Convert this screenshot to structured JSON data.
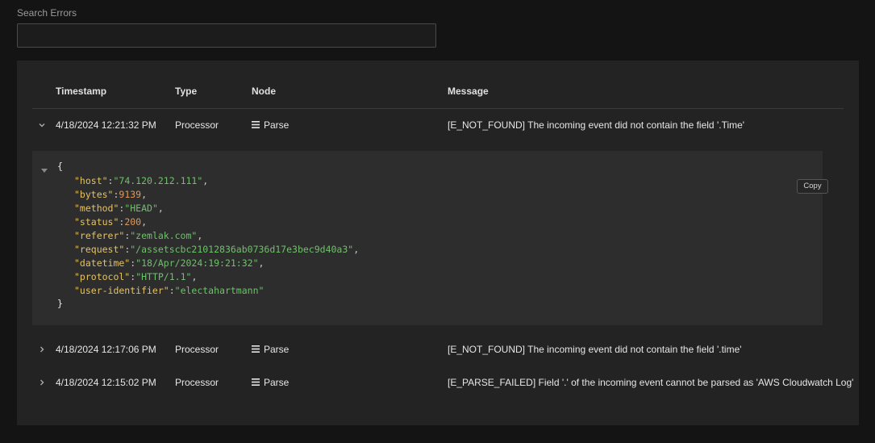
{
  "search": {
    "label": "Search Errors",
    "placeholder": "",
    "value": ""
  },
  "table": {
    "columns": {
      "timestamp": "Timestamp",
      "type": "Type",
      "node": "Node",
      "message": "Message"
    },
    "rows": [
      {
        "timestamp": "4/18/2024 12:21:32 PM",
        "type": "Processor",
        "node": "Parse",
        "message": "[E_NOT_FOUND] The incoming event did not contain the field '.Time'",
        "expanded": true
      },
      {
        "timestamp": "4/18/2024 12:17:06 PM",
        "type": "Processor",
        "node": "Parse",
        "message": "[E_NOT_FOUND] The incoming event did not contain the field '.time'",
        "expanded": false
      },
      {
        "timestamp": "4/18/2024 12:15:02 PM",
        "type": "Processor",
        "node": "Parse",
        "message": "[E_PARSE_FAILED] Field '.' of the incoming event cannot be parsed as 'AWS Cloudwatch Log'",
        "expanded": false
      }
    ]
  },
  "event_json": {
    "open_brace": "{",
    "close_brace": "}",
    "copy_label": "Copy",
    "fields": [
      {
        "key": "\"host\"",
        "value": "\"74.120.212.111\"",
        "value_type": "string",
        "comma": ","
      },
      {
        "key": "\"bytes\"",
        "value": "9139",
        "value_type": "number",
        "comma": ","
      },
      {
        "key": "\"method\"",
        "value": "\"HEAD\"",
        "value_type": "string",
        "comma": ","
      },
      {
        "key": "\"status\"",
        "value": "200",
        "value_type": "number",
        "comma": ","
      },
      {
        "key": "\"referer\"",
        "value": "\"zemlak.com\"",
        "value_type": "string",
        "comma": ","
      },
      {
        "key": "\"request\"",
        "value": "\"/assetscbc21012836ab0736d17e3bec9d40a3\"",
        "value_type": "string",
        "comma": ","
      },
      {
        "key": "\"datetime\"",
        "value": "\"18/Apr/2024:19:21:32\"",
        "value_type": "string",
        "comma": ","
      },
      {
        "key": "\"protocol\"",
        "value": "\"HTTP/1.1\"",
        "value_type": "string",
        "comma": ","
      },
      {
        "key": "\"user-identifier\"",
        "value": "\"electahartmann\"",
        "value_type": "string",
        "comma": ""
      }
    ]
  },
  "colors": {
    "background": "#141414",
    "panel": "#232323",
    "json_box": "#2d2d2d",
    "key": "#e3c266",
    "string": "#6fc06b",
    "number": "#e0985a"
  },
  "icons": {
    "expanded": "chevron-down-icon",
    "collapsed": "chevron-right-icon",
    "node": "list-icon",
    "json_toggle": "caret-down-icon"
  }
}
